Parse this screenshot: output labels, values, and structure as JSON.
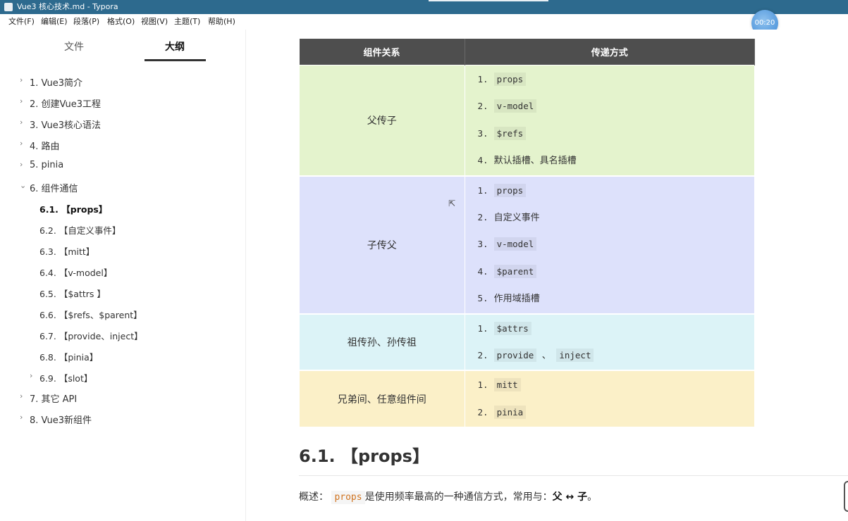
{
  "window": {
    "title": "Vue3 核心技术.md - Typora"
  },
  "menu": [
    "文件(F)",
    "编辑(E)",
    "段落(P)",
    "格式(O)",
    "视图(V)",
    "主题(T)",
    "帮助(H)"
  ],
  "timer": "00:20",
  "sidebar": {
    "tabs": [
      "文件",
      "大纲"
    ],
    "outline": [
      {
        "label": "1. Vue3简介"
      },
      {
        "label": "2. 创建Vue3工程"
      },
      {
        "label": "3. Vue3核心语法"
      },
      {
        "label": "4. 路由"
      },
      {
        "label": "5. pinia"
      },
      {
        "label": "6. 组件通信"
      },
      {
        "label": "6.1. 【props】"
      },
      {
        "label": "6.2. 【自定义事件】"
      },
      {
        "label": "6.3. 【mitt】"
      },
      {
        "label": "6.4. 【v-model】"
      },
      {
        "label": "6.5. 【$attrs 】"
      },
      {
        "label": "6.6. 【$refs、$parent】"
      },
      {
        "label": "6.7. 【provide、inject】"
      },
      {
        "label": "6.8. 【pinia】"
      },
      {
        "label": "6.9. 【slot】"
      },
      {
        "label": "7. 其它 API"
      },
      {
        "label": "8. Vue3新组件"
      }
    ]
  },
  "table": {
    "headers": [
      "组件关系",
      "传递方式"
    ],
    "rows": [
      {
        "relation": "父传子",
        "items": [
          {
            "num": "1.",
            "code": "props",
            "text": ""
          },
          {
            "num": "2.",
            "code": "v-model",
            "text": ""
          },
          {
            "num": "3.",
            "code": "$refs",
            "text": ""
          },
          {
            "num": "4.",
            "code": "",
            "text": "默认插槽、具名插槽"
          }
        ]
      },
      {
        "relation": "子传父",
        "items": [
          {
            "num": "1.",
            "code": "props",
            "text": ""
          },
          {
            "num": "2.",
            "code": "",
            "text": "自定义事件"
          },
          {
            "num": "3.",
            "code": "v-model",
            "text": ""
          },
          {
            "num": "4.",
            "code": "$parent",
            "text": ""
          },
          {
            "num": "5.",
            "code": "",
            "text": "作用域插槽"
          }
        ]
      },
      {
        "relation": "祖传孙、孙传祖",
        "items": [
          {
            "num": "1.",
            "code": "$attrs",
            "text": ""
          },
          {
            "num": "2.",
            "code": "provide",
            "text": "、",
            "code2": "inject"
          }
        ]
      },
      {
        "relation": "兄弟间、任意组件间",
        "items": [
          {
            "num": "1.",
            "code": "mitt",
            "text": ""
          },
          {
            "num": "2.",
            "code": "pinia",
            "text": ""
          }
        ]
      }
    ]
  },
  "section": {
    "heading": "6.1. 【props】",
    "para_prefix": "概述：",
    "para_code": "props",
    "para_mid": "是使用频率最高的一种通信方式，常用与：",
    "para_bold": "父 ↔ 子",
    "para_end": "。"
  }
}
